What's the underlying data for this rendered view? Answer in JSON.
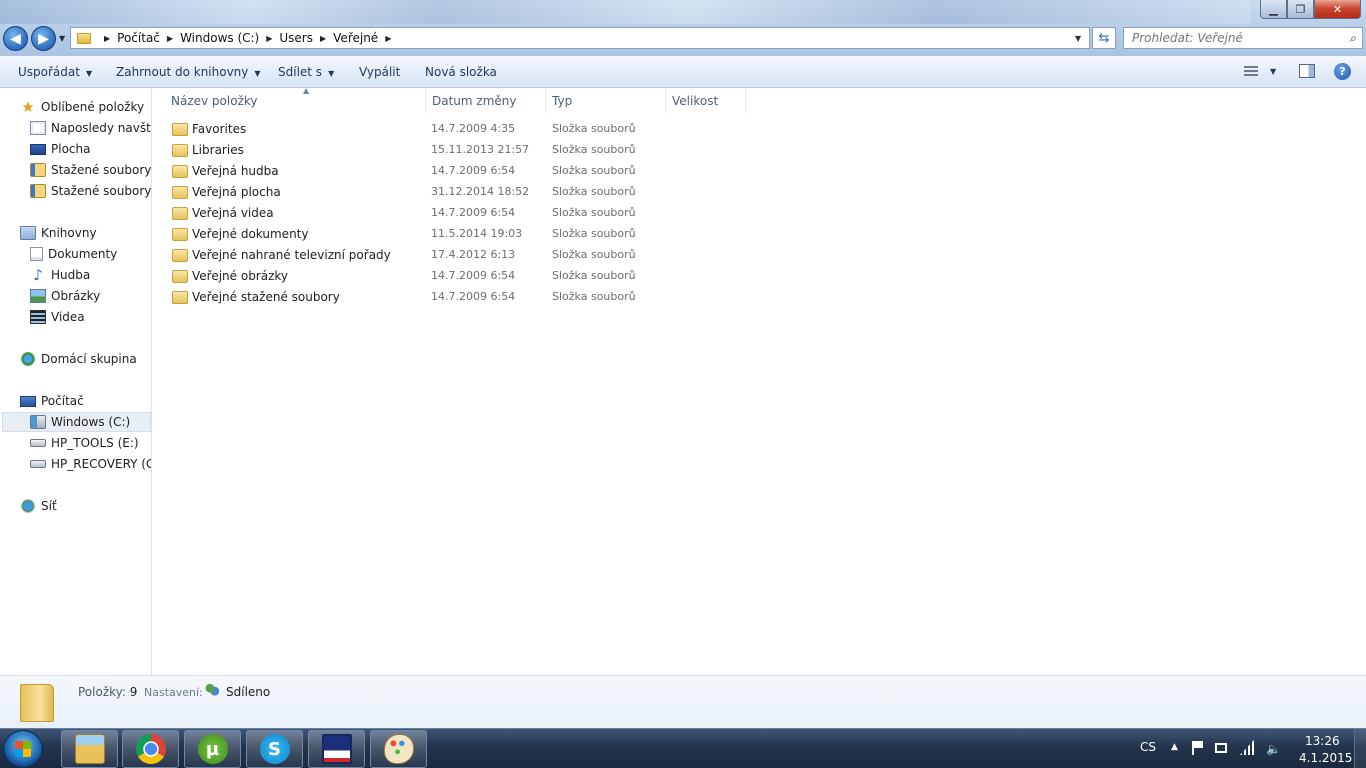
{
  "window": {
    "buttons": {
      "minimize": "▁",
      "maximize": "❐",
      "close": "✕"
    }
  },
  "address": {
    "crumbs": [
      "Počítač",
      "Windows (C:)",
      "Users",
      "Veřejné"
    ]
  },
  "search": {
    "placeholder": "Prohledat: Veřejné"
  },
  "toolbar": {
    "organize": "Uspořádat",
    "include_library": "Zahrnout do knihovny",
    "share": "Sdílet s",
    "burn": "Vypálit",
    "new_folder": "Nová složka",
    "help": "?"
  },
  "sidebar": {
    "favorites": {
      "title": "Oblíbené položky",
      "items": [
        "Naposledy navštívené",
        "Plocha",
        "Stažené soubory",
        "Stažené soubory"
      ]
    },
    "libraries": {
      "title": "Knihovny",
      "items": [
        "Dokumenty",
        "Hudba",
        "Obrázky",
        "Videa"
      ]
    },
    "homegroup": "Domácí skupina",
    "computer": {
      "title": "Počítač",
      "items": [
        "Windows (C:)",
        "HP_TOOLS (E:)",
        "HP_RECOVERY (G:)"
      ],
      "selected": "Windows (C:)"
    },
    "network": "Síť"
  },
  "file_list": {
    "columns": [
      "Název položky",
      "Datum změny",
      "Typ",
      "Velikost"
    ],
    "rows": [
      {
        "name": "Favorites",
        "date": "14.7.2009 4:35",
        "type": "Složka souborů"
      },
      {
        "name": "Libraries",
        "date": "15.11.2013 21:57",
        "type": "Složka souborů"
      },
      {
        "name": "Veřejná hudba",
        "date": "14.7.2009 6:54",
        "type": "Složka souborů"
      },
      {
        "name": "Veřejná plocha",
        "date": "31.12.2014 18:52",
        "type": "Složka souborů"
      },
      {
        "name": "Veřejná videa",
        "date": "14.7.2009 6:54",
        "type": "Složka souborů"
      },
      {
        "name": "Veřejné dokumenty",
        "date": "11.5.2014 19:03",
        "type": "Složka souborů"
      },
      {
        "name": "Veřejné nahrané televizní pořady",
        "date": "17.4.2012 6:13",
        "type": "Složka souborů"
      },
      {
        "name": "Veřejné obrázky",
        "date": "14.7.2009 6:54",
        "type": "Složka souborů"
      },
      {
        "name": "Veřejné stažené soubory",
        "date": "14.7.2009 6:54",
        "type": "Složka souborů"
      }
    ]
  },
  "details": {
    "items_label": "Položky:",
    "items_count": "9",
    "setting_label": "Nastavení:",
    "setting_value": "Sdíleno"
  },
  "taskbar": {
    "apps": [
      "explorer",
      "chrome",
      "utorrent",
      "skype",
      "save",
      "paint"
    ],
    "utorrent_glyph": "µ",
    "skype_glyph": "S",
    "language": "CS",
    "time": "13:26",
    "date": "4.1.2015"
  }
}
